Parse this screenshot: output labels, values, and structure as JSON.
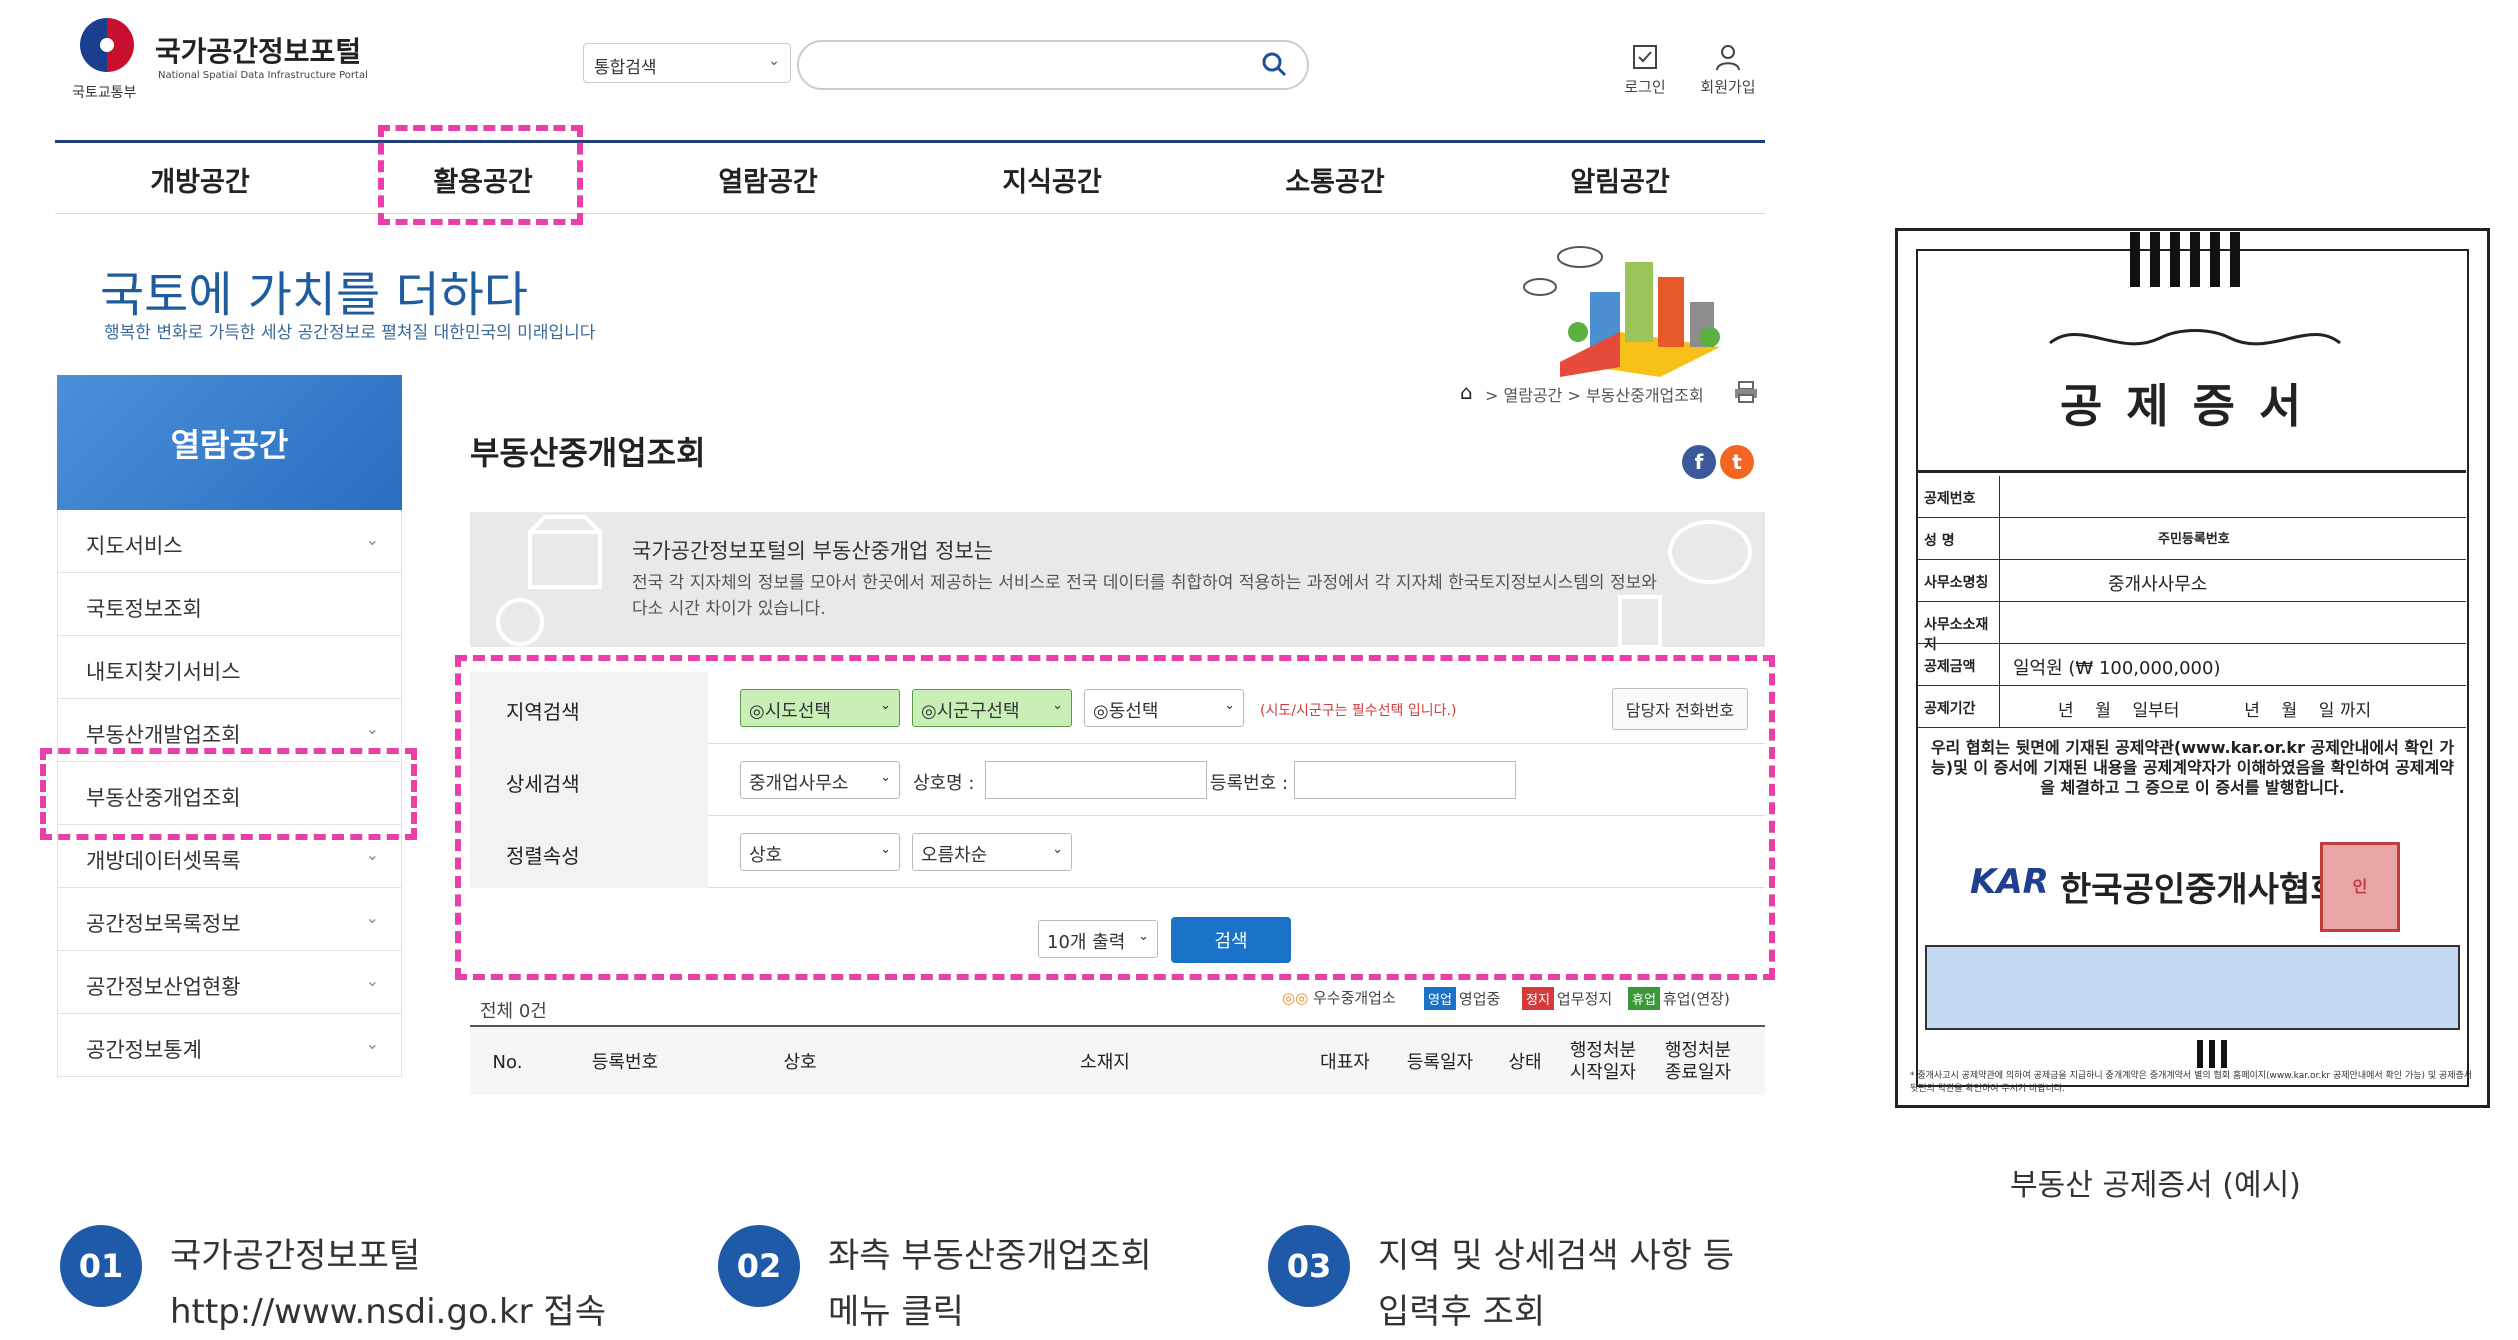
{
  "header": {
    "ministry": "국토교통부",
    "portal_title": "국가공간정보포털",
    "portal_sub": "National Spatial Data Infrastructure Portal",
    "search_scope": "통합검색",
    "login": "로그인",
    "signup": "회원가입"
  },
  "nav": [
    "개방공간",
    "활용공간",
    "열람공간",
    "지식공간",
    "소통공간",
    "알림공간"
  ],
  "hero": {
    "title": "국토에 가치를 더하다",
    "subtitle": "행복한 변화로 가득한 세상 공간정보로 펼쳐질 대한민국의 미래입니다"
  },
  "sidebar": {
    "title": "열람공간",
    "items": [
      "지도서비스",
      "국토정보조회",
      "내토지찾기서비스",
      "부동산개발업조회",
      "부동산중개업조회",
      "개방데이터셋목록",
      "공간정보목록정보",
      "공간정보산업현황",
      "공간정보통계"
    ]
  },
  "main": {
    "breadcrumb": "> 열람공간 > 부동산중개업조회",
    "title": "부동산중개업조회",
    "info_title": "국가공간정보포털의 부동산중개업 정보는",
    "info_desc": "전국 각 지자체의 정보를 모아서 한곳에서 제공하는 서비스로 전국 데이터를 취합하여 적용하는 과정에서 각 지자체 한국토지정보시스템의 정보와 다소 시간 차이가 있습니다."
  },
  "form": {
    "region_label": "지역검색",
    "sido": "◎시도선택",
    "sigungu": "◎시군구선택",
    "dong": "◎동선택",
    "required_note": "(시도/시군구는 필수선택 입니다.)",
    "contact_btn": "담당자 전화번호",
    "detail_label": "상세검색",
    "office_type": "중개업사무소",
    "name_label": "상호명 :",
    "reg_label": "등록번호 :",
    "sort_label": "정렬속성",
    "sort_field": "상호",
    "sort_order": "오름차순",
    "page_size": "10개 출력",
    "search_btn": "검색"
  },
  "legend": {
    "excellent": "우수중개업소",
    "b1": "영업",
    "l1": "영업중",
    "b2": "정지",
    "l2": "업무정지",
    "b3": "휴업",
    "l3": "휴업(연장)"
  },
  "colors": {
    "badge_open": "#1a73c8",
    "badge_stop": "#d63b3b",
    "badge_rest": "#3a9a3a"
  },
  "table": {
    "total": "전체 0건",
    "headers": [
      "No.",
      "등록번호",
      "상호",
      "소재지",
      "대표자",
      "등록일자",
      "상태",
      "행정처분\n시작일자",
      "행정처분\n종료일자"
    ]
  },
  "certificate": {
    "title": "공제증서",
    "rows": [
      {
        "k": "공제번호",
        "v": ""
      },
      {
        "k": "성    명",
        "v": "주민등록번호"
      },
      {
        "k": "사무소명칭",
        "v": "중개사사무소"
      },
      {
        "k": "사무소소재지",
        "v": ""
      },
      {
        "k": "공제금액",
        "v": "일억원 (₩ 100,000,000)"
      },
      {
        "k": "공제기간",
        "v": "년    월    일부터            년    월    일 까지"
      }
    ],
    "body": "우리 협회는 뒷면에 기재된 공제약관(www.kar.or.kr 공제안내에서 확인 가능)및 이 증서에 기재된 내용을 공제계약자가 이해하였음을 확인하여 공제계약을 체결하고 그 증으로 이 증서를 발행합니다.",
    "assoc": "한국공인중개사협회장",
    "assoc_logo": "KAR",
    "seal": "인",
    "footnote": "* 중개사고시 공제약관에 의하여 공제금을 지급하니 중개계약은 중개계약서 별의 협회 홈페이지(www.kar.or.kr 공제안내에서 확인 가능) 및 공제증서 뒷면의 약관을 확인하여 주시기 바랍니다.",
    "caption": "부동산 공제증서 (예시)"
  },
  "steps": [
    {
      "num": "01",
      "line1": "국가공간정보포털",
      "line2": "http://www.nsdi.go.kr 접속"
    },
    {
      "num": "02",
      "line1": "좌측 부동산중개업조회",
      "line2": "메뉴 클릭"
    },
    {
      "num": "03",
      "line1": "지역 및 상세검색 사항 등",
      "line2": "입력후 조회"
    }
  ]
}
